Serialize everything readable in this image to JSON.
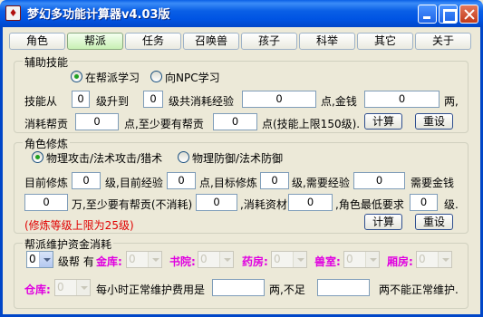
{
  "window": {
    "title": "梦幻多功能计算器v4.03版",
    "icon": "bag-icon"
  },
  "tabs": [
    {
      "label": "角色",
      "active": false
    },
    {
      "label": "帮派",
      "active": true
    },
    {
      "label": "任务",
      "active": false
    },
    {
      "label": "召唤兽",
      "active": false
    },
    {
      "label": "孩子",
      "active": false
    },
    {
      "label": "科举",
      "active": false
    },
    {
      "label": "其它",
      "active": false
    },
    {
      "label": "关于",
      "active": false
    }
  ],
  "aux_skill": {
    "legend": "辅助技能",
    "radio_gang": "在帮派学习",
    "radio_npc": "向NPC学习",
    "radio_selected": "radio_gang",
    "label_from": "技能从",
    "from_value": "0",
    "label_upgrade_to": "级升到",
    "to_value": "0",
    "label_total_exp": "级共消耗经验",
    "total_exp_value": "0",
    "label_gold": "点,金钱",
    "gold_value": "0",
    "label_liang": "两,",
    "label_contrib": "消耗帮贡",
    "contrib_value": "0",
    "label_at_least": "点,至少要有帮贡",
    "min_contrib_value": "0",
    "label_limit": "点(技能上限150级).",
    "calc_button": "计算",
    "reset_button": "重设"
  },
  "cultivation": {
    "legend": "角色修炼",
    "radio_attack": "物理攻击/法术攻击/猎术",
    "radio_defense": "物理防御/法术防御",
    "radio_selected": "radio_attack",
    "label_current": "目前修炼",
    "current_value": "0",
    "label_current_exp": "级,目前经验",
    "current_exp_value": "0",
    "label_target": "点,目标修炼",
    "target_value": "0",
    "label_need_exp": "级,需要经验",
    "need_exp_value": "0",
    "label_need_gold": "需要金钱",
    "gold_value": "0",
    "label_min_contrib": "万,至少要有帮贡(不消耗)",
    "min_contrib_value": "0",
    "label_materials": ",消耗资材",
    "materials_value": "0",
    "label_min_level": ",角色最低要求",
    "min_level_value": "0",
    "label_ji": "级.",
    "note": "(修炼等级上限为25级)",
    "calc_button": "计算",
    "reset_button": "重设"
  },
  "gang_maintenance": {
    "legend": "帮派维护资金消耗",
    "gang_level_value": "0",
    "label_gang_has": "级帮 有",
    "treasury_label": "金库:",
    "treasury_value": "0",
    "academy_label": "书院:",
    "academy_value": "0",
    "pharmacy_label": "药房:",
    "pharmacy_value": "0",
    "beast_label": "兽室:",
    "beast_value": "0",
    "wing_label": "厢房:",
    "wing_value": "0",
    "warehouse_label": "仓库:",
    "warehouse_value": "0",
    "label_hourly": "每小时正常维护费用是",
    "hourly_value": "",
    "label_insufficient": "两,不足",
    "insufficient_value": "",
    "label_cannot": "两不能正常维护."
  }
}
